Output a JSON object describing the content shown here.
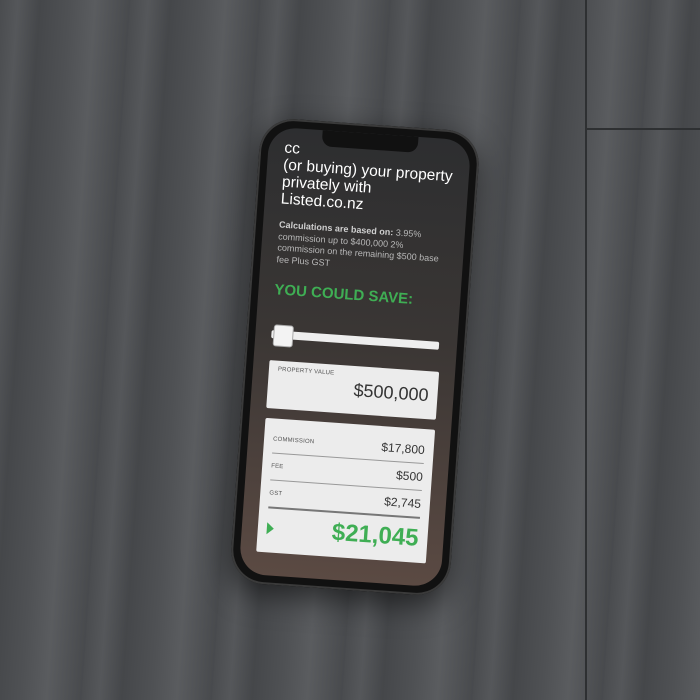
{
  "app": {
    "headline_partial": "cc",
    "headline": "(or buying) your property privately with Listed.co.nz",
    "calc_label": "Calculations are based on:",
    "calc_text": "3.95% commission up to $400,000 2% commission on the remaining $500 base fee Plus GST",
    "save_heading": "YOU COULD SAVE:",
    "slider_level": 0,
    "property_value_label": "PROPERTY VALUE",
    "property_value": "$500,000",
    "rows": [
      {
        "label": "COMMISSION",
        "value": "$17,800"
      },
      {
        "label": "FEE",
        "value": "$500"
      },
      {
        "label": "GST",
        "value": "$2,745"
      }
    ],
    "total": "$21,045",
    "accent_color": "#3fae54"
  }
}
